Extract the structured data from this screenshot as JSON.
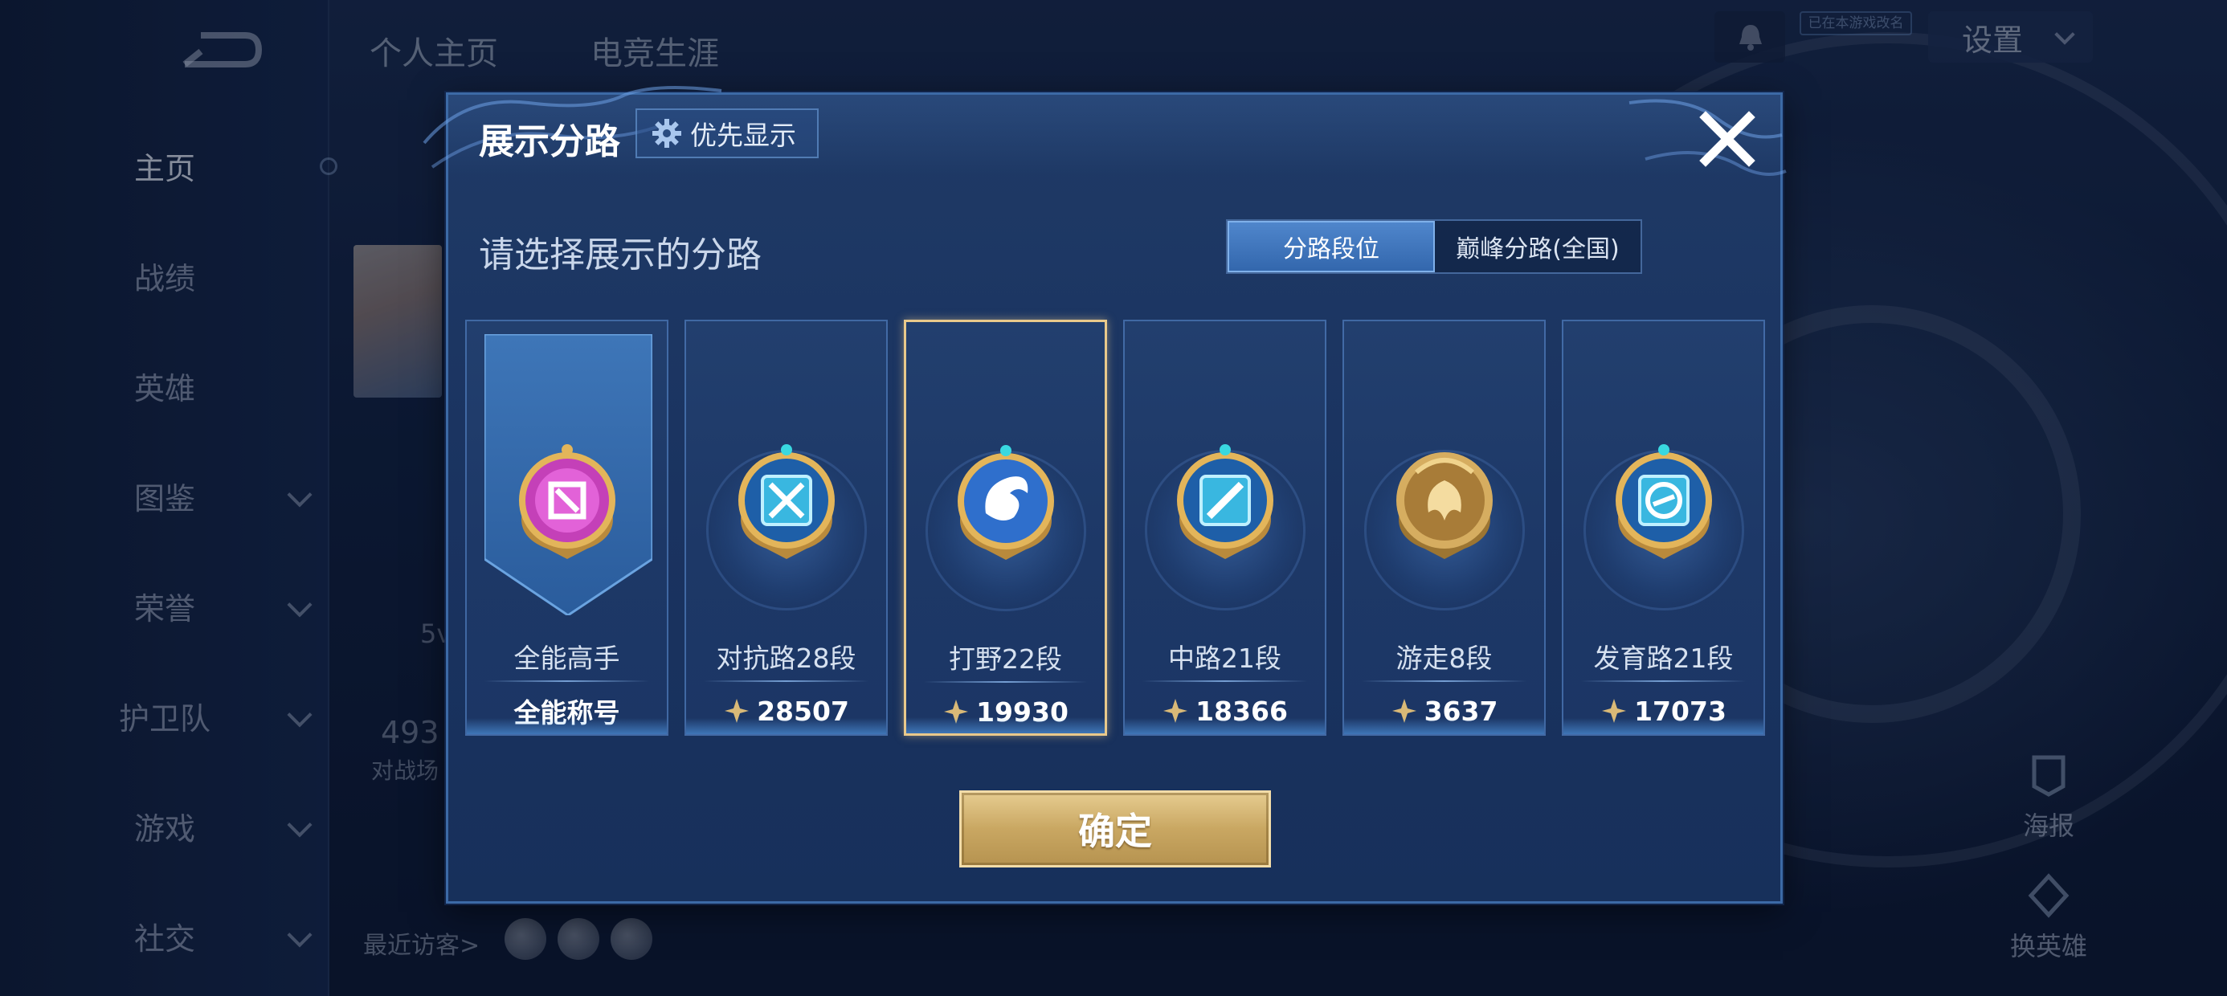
{
  "background": {
    "nav_items": [
      {
        "label": "主页",
        "active": true,
        "has_arrow": false
      },
      {
        "label": "战绩",
        "active": false,
        "has_arrow": false
      },
      {
        "label": "英雄",
        "active": false,
        "has_arrow": false
      },
      {
        "label": "图鉴",
        "active": false,
        "has_arrow": true
      },
      {
        "label": "荣誉",
        "active": false,
        "has_arrow": true
      },
      {
        "label": "护卫队",
        "active": false,
        "has_arrow": true
      },
      {
        "label": "游戏",
        "active": false,
        "has_arrow": true
      },
      {
        "label": "社交",
        "active": false,
        "has_arrow": true
      }
    ],
    "top_tabs": [
      "个人主页",
      "电竞生涯"
    ],
    "settings_label": "设置",
    "streak_tag": "已在本游戏改名",
    "faint_texts": [
      "5v",
      "493",
      "对战场"
    ],
    "recent_visitors_label": "最近访客>",
    "side_buttons": [
      "海报",
      "换英雄"
    ]
  },
  "modal": {
    "title": "展示分路",
    "priority_label": "优先显示",
    "subtitle": "请选择展示的分路",
    "tabs": [
      {
        "label": "分路段位",
        "active": true
      },
      {
        "label": "巅峰分路(全国)",
        "active": false
      }
    ],
    "cards": [
      {
        "label": "全能高手",
        "value": "全能称号",
        "score_icon": false,
        "selected": false,
        "badge": "all-round-badge-icon",
        "badge_color": "#c440b8"
      },
      {
        "label": "对抗路28段",
        "value": "28507",
        "score_icon": true,
        "selected": false,
        "badge": "clash-lane-badge-icon",
        "badge_color": "#39b7e0"
      },
      {
        "label": "打野22段",
        "value": "19930",
        "score_icon": true,
        "selected": true,
        "badge": "jungle-badge-icon",
        "badge_color": "#2f6fcc"
      },
      {
        "label": "中路21段",
        "value": "18366",
        "score_icon": true,
        "selected": false,
        "badge": "mid-lane-badge-icon",
        "badge_color": "#39b7e0"
      },
      {
        "label": "游走8段",
        "value": "3637",
        "score_icon": true,
        "selected": false,
        "badge": "roam-badge-icon",
        "badge_color": "#c99a45"
      },
      {
        "label": "发育路21段",
        "value": "17073",
        "score_icon": true,
        "selected": false,
        "badge": "farm-lane-badge-icon",
        "badge_color": "#39b7e0"
      }
    ],
    "confirm_label": "确定"
  },
  "colors": {
    "accent_blue": "#3367ad",
    "selected_border": "#e9c98b",
    "confirm_gold": "#c9a762"
  }
}
